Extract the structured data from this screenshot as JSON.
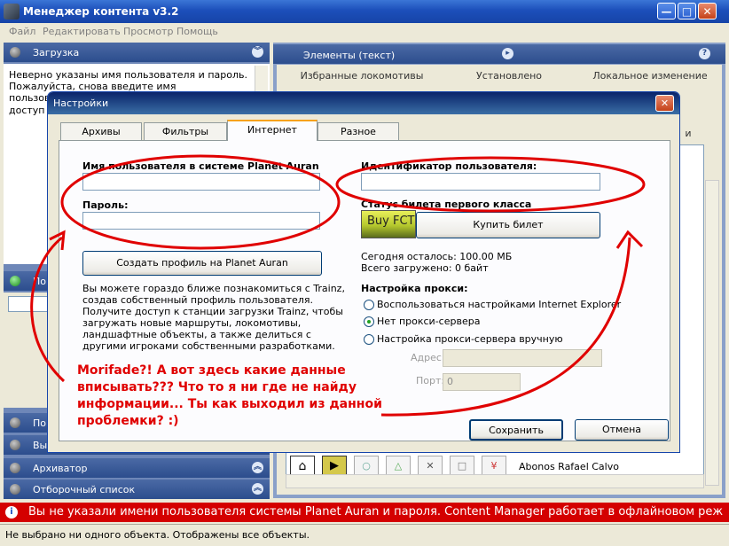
{
  "window": {
    "title": "Менеджер контента v3.2",
    "minimize": "—",
    "maximize": "□",
    "close": "✕"
  },
  "menu": [
    "Файл",
    "Редактировать",
    "Просмотр",
    "Помощь"
  ],
  "left_panel": {
    "download_header": "Загрузка",
    "download_message": "Неверно указаны имя пользователя и пароль. Пожалуйста, снова введите имя пользователя в системе",
    "download_message_tail": "доступ к",
    "section_partial_1": "По",
    "section_partial_2": "Вы",
    "archiver": "Архиватор",
    "selection_list": "Отборочный список"
  },
  "right_panel": {
    "header": "Элементы (текст)",
    "tabs": [
      "Избранные локомотивы",
      "Установлено",
      "Локальное изменение"
    ],
    "partial_tab": "и",
    "row_author": "Abonos Rafael Calvo"
  },
  "dialog": {
    "title": "Настройки",
    "tabs": [
      "Архивы",
      "Фильтры",
      "Интернет",
      "Разное"
    ],
    "username_label": "Имя пользователя в системе Planet Auran",
    "password_label": "Пароль:",
    "create_profile_button": "Создать профиль на Planet Auran",
    "info_text": [
      "Вы можете гораздо ближе познакомиться с Trainz,",
      "создав собственный профиль пользователя.",
      "Получите доступ к станции загрузки Trainz, чтобы",
      "загружать новые маршруты, локомотивы,",
      "ландшафтные объекты, а также делиться с",
      "другими игроками собственными разработками."
    ],
    "user_id_label": "Идентификатор пользователя:",
    "ticket_status_label": "Статус билета первого класса",
    "buy_fct_label": "Buy FCT",
    "buy_ticket_button": "Купить билет",
    "remaining_today": "Сегодня осталось: 100.00 МБ",
    "total_downloaded": "Всего загружено: 0 байт",
    "proxy_settings_label": "Настройка прокси:",
    "proxy_options": [
      "Воспользоваться настройками Internet Explorer",
      "Нет прокси-сервера",
      "Настройка прокси-сервера вручную"
    ],
    "address_label": "Адрес:",
    "port_label": "Порт:",
    "port_value": "0",
    "save_button": "Сохранить",
    "cancel_button": "Отмена"
  },
  "annotation": {
    "lines": [
      "Morifade?! А вот здесь какие данные",
      "вписывать??? Что то я ни где не найду",
      "информации... Ты как выходил из данной",
      "проблемки? :)"
    ],
    "color": "#e00000"
  },
  "red_status": "Вы не указали имени пользователя системы Planet Auran и пароля. Content Manager работает в офлайновом реж",
  "status_bar": "Не выбрано ни одного объекта. Отображены все объекты."
}
